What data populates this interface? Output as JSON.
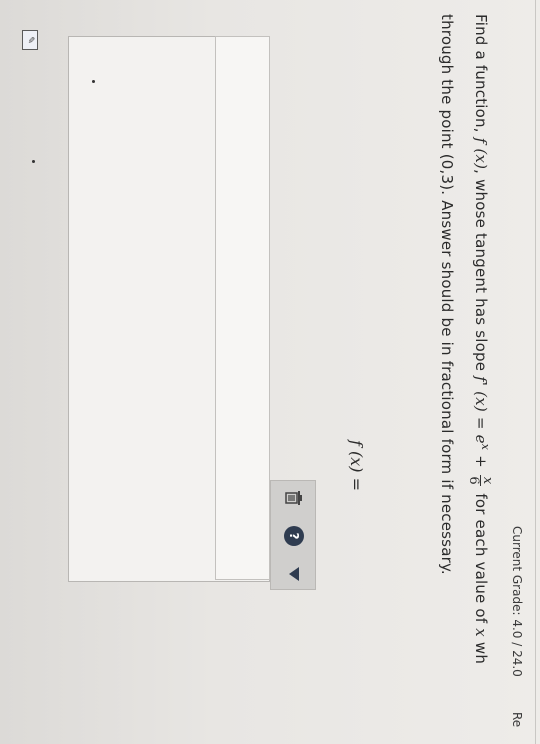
{
  "header": {
    "grade": "Current Grade: 4.0 / 24.0",
    "report": "Re"
  },
  "question": {
    "p1": "Find a function, ",
    "fx": "f (x)",
    "p2": ", whose tangent has slope ",
    "fpx": "f' (x)",
    "p3": " = e",
    "exp": "x",
    "p4": " + ",
    "frac_num": "x",
    "frac_den": "6",
    "p5": " for each value of ",
    "var": "x",
    "p6": " wh",
    "line2": "through the point (0,3). Answer should be in fractional form if necessary."
  },
  "answer": {
    "label": "f (x) =",
    "value": "",
    "placeholder": ""
  },
  "toolbar": {
    "help_label": "?"
  },
  "icons": [
    "trash-icon",
    "help-icon",
    "triangle-down-icon",
    "sidebar-tool-icon"
  ]
}
